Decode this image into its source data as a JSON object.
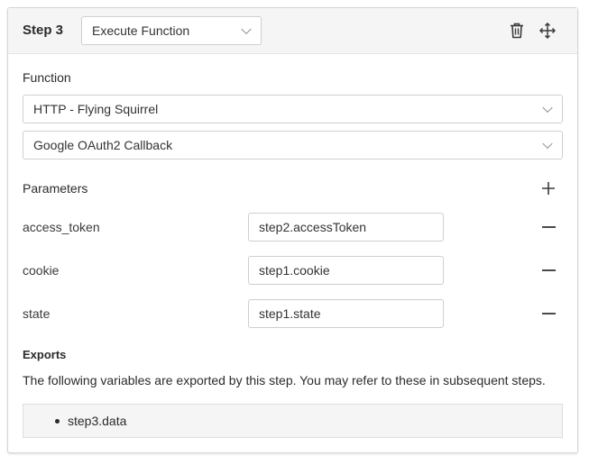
{
  "step": {
    "label": "Step 3",
    "action": "Execute Function"
  },
  "function": {
    "label": "Function",
    "provider": "HTTP - Flying Squirrel",
    "operation": "Google OAuth2 Callback"
  },
  "parameters": {
    "label": "Parameters",
    "items": [
      {
        "name": "access_token",
        "value": "step2.accessToken"
      },
      {
        "name": "cookie",
        "value": "step1.cookie"
      },
      {
        "name": "state",
        "value": "step1.state"
      }
    ]
  },
  "exports": {
    "title": "Exports",
    "description": "The following variables are exported by this step. You may refer to these in subsequent steps.",
    "items": [
      "step3.data"
    ]
  },
  "icons": {
    "delete": "trash-icon",
    "move": "move-icon",
    "add": "plus-icon",
    "remove": "minus-icon"
  }
}
